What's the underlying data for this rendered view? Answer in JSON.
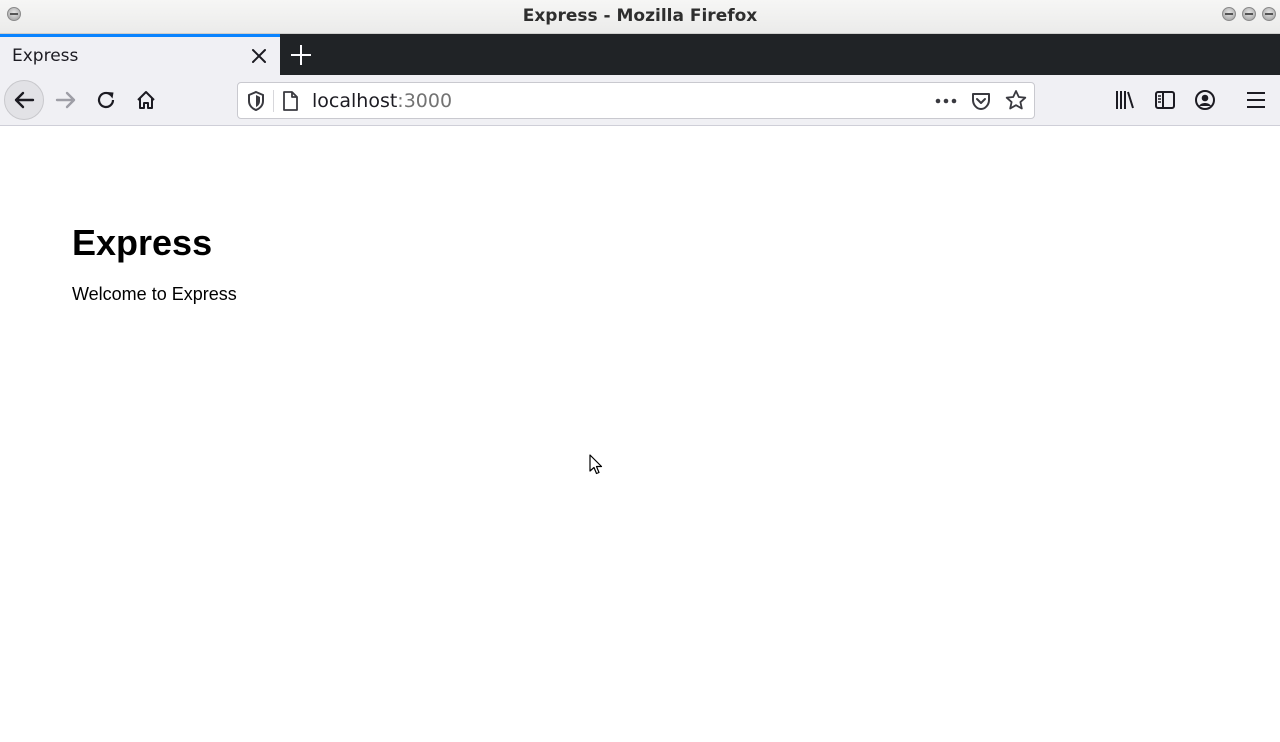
{
  "window": {
    "title": "Express - Mozilla Firefox"
  },
  "tabs": [
    {
      "label": "Express",
      "active": true
    }
  ],
  "toolbar": {
    "url_host": "localhost",
    "url_port": ":3000",
    "icons": [
      "back-arrow-icon",
      "forward-arrow-icon",
      "reload-icon",
      "home-icon",
      "tracking-shield-icon",
      "page-icon",
      "page-actions-icon",
      "pocket-icon",
      "bookmark-star-icon",
      "library-icon",
      "sidebar-icon",
      "account-icon",
      "menu-icon"
    ]
  },
  "page": {
    "heading": "Express",
    "text": "Welcome to Express"
  },
  "colors": {
    "tab_accent": "#0a84ff",
    "tabstrip_bg": "#202326",
    "toolbar_bg": "#f0f0f4"
  }
}
